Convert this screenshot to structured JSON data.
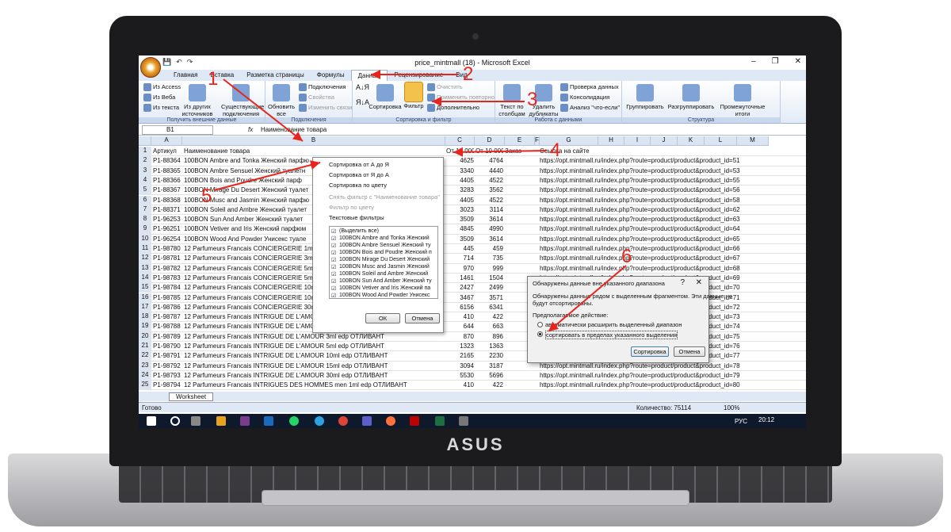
{
  "window": {
    "title": "price_mintmall (18) - Microsoft Excel",
    "controls": [
      "–",
      "❐",
      "✕"
    ]
  },
  "qat": [
    "💾",
    "↶",
    "↷"
  ],
  "tabs": [
    "Главная",
    "Вставка",
    "Разметка страницы",
    "Формулы",
    "Данные",
    "Рецензирование",
    "Вид"
  ],
  "ribbon": {
    "ext": {
      "access": "Из Access",
      "web": "Из Веба",
      "text": "Из текста",
      "other": "Из других источников",
      "existing": "Существующие подключения",
      "label": "Получить внешние данные"
    },
    "conn": {
      "refresh": "Обновить все",
      "connections": "Подключения",
      "properties": "Свойства",
      "editlinks": "Изменить связи",
      "label": "Подключения"
    },
    "sort": {
      "sort": "Сортировка",
      "filter": "Фильтр",
      "clear": "Очистить",
      "reapply": "Применить повторно",
      "advanced": "Дополнительно",
      "label": "Сортировка и фильтр"
    },
    "tools": {
      "text": "Текст по столбцам",
      "dup": "Удалить дубликаты",
      "validation": "Проверка данных",
      "consolidate": "Консолидация",
      "whatif": "Анализ \"что-если\"",
      "label": "Работа с данными"
    },
    "outline": {
      "group": "Группировать",
      "ungroup": "Разгруппировать",
      "subtotal": "Промежуточные итоги",
      "label": "Структура"
    }
  },
  "formula": {
    "cell": "B1",
    "fx": "fx",
    "value": "Наименование товара"
  },
  "columns": [
    "A",
    "B",
    "C",
    "D",
    "E",
    "F",
    "G",
    "H",
    "I",
    "J",
    "K",
    "L",
    "M"
  ],
  "rows": [
    {
      "n": "1",
      "a": "Артикул",
      "b": "Наименование товара",
      "c": "От 10 000",
      "d": "От 10 000",
      "e": "Заказ",
      "f": "Ссылка на сайте"
    },
    {
      "n": "2",
      "a": "P1-88364",
      "b": "100BON Ambre and Tonka Женский парфю",
      "c": "4625",
      "d": "4764",
      "e": "",
      "f": "https://opt.mintmall.ru/index.php?route=product/product&product_id=51"
    },
    {
      "n": "3",
      "a": "P1-88365",
      "b": "100BON Ambre Sensuel Женский туалетн",
      "c": "3340",
      "d": "4440",
      "e": "",
      "f": "https://opt.mintmall.ru/index.php?route=product/product&product_id=53"
    },
    {
      "n": "4",
      "a": "P1-88366",
      "b": "100BON Bois and Poudre Женский парф",
      "c": "4405",
      "d": "4522",
      "e": "",
      "f": "https://opt.mintmall.ru/index.php?route=product/product&product_id=55"
    },
    {
      "n": "5",
      "a": "P1-88367",
      "b": "100BON Mirage Du Desert Женский туалет",
      "c": "3283",
      "d": "3562",
      "e": "",
      "f": "https://opt.mintmall.ru/index.php?route=product/product&product_id=56"
    },
    {
      "n": "6",
      "a": "P1-88368",
      "b": "100BON Musc and Jasmin Женский парфю",
      "c": "4405",
      "d": "4522",
      "e": "",
      "f": "https://opt.mintmall.ru/index.php?route=product/product&product_id=58"
    },
    {
      "n": "7",
      "a": "P1-88371",
      "b": "100BON Soleil and Ambre Женский туалет",
      "c": "3023",
      "d": "3114",
      "e": "",
      "f": "https://opt.mintmall.ru/index.php?route=product/product&product_id=62"
    },
    {
      "n": "8",
      "a": "P1-96253",
      "b": "100BON Sun And Amber Женский туалет",
      "c": "3509",
      "d": "3614",
      "e": "",
      "f": "https://opt.mintmall.ru/index.php?route=product/product&product_id=63"
    },
    {
      "n": "9",
      "a": "P1-96251",
      "b": "100BON Vetiver and Iris Женский парфюм",
      "c": "4845",
      "d": "4990",
      "e": "",
      "f": "https://opt.mintmall.ru/index.php?route=product/product&product_id=64"
    },
    {
      "n": "10",
      "a": "P1-96254",
      "b": "100BON Wood And Powder Унисекс туале",
      "c": "3509",
      "d": "3614",
      "e": "",
      "f": "https://opt.mintmall.ru/index.php?route=product/product&product_id=65"
    },
    {
      "n": "11",
      "a": "P1-98780",
      "b": "12 Parfumeurs Francais CONCIERGERIE 1ml",
      "c": "445",
      "d": "459",
      "e": "",
      "f": "https://opt.mintmall.ru/index.php?route=product/product&product_id=66"
    },
    {
      "n": "12",
      "a": "P1-98781",
      "b": "12 Parfumeurs Francais CONCIERGERIE 3ml",
      "c": "714",
      "d": "735",
      "e": "",
      "f": "https://opt.mintmall.ru/index.php?route=product/product&product_id=67"
    },
    {
      "n": "13",
      "a": "P1-98782",
      "b": "12 Parfumeurs Francais CONCIERGERIE 5ml",
      "c": "970",
      "d": "999",
      "e": "",
      "f": "https://opt.mintmall.ru/index.php?route=product/product&product_id=68"
    },
    {
      "n": "14",
      "a": "P1-98783",
      "b": "12 Parfumeurs Francais CONCIERGERIE 5ml",
      "c": "1461",
      "d": "1504",
      "e": "",
      "f": "https://opt.mintmall.ru/index.php?route=product/product&product_id=69"
    },
    {
      "n": "15",
      "a": "P1-98784",
      "b": "12 Parfumeurs Francais CONCIERGERIE 10m",
      "c": "2427",
      "d": "2499",
      "e": "",
      "f": "https://opt.mintmall.ru/index.php?route=product/product&product_id=70"
    },
    {
      "n": "16",
      "a": "P1-98785",
      "b": "12 Parfumeurs Francais CONCIERGERIE 10m",
      "c": "3467",
      "d": "3571",
      "e": "",
      "f": "https://opt.mintmall.ru/index.php?route=product/product&product_id=71"
    },
    {
      "n": "17",
      "a": "P1-98786",
      "b": "12 Parfumeurs Francais CONCIERGERIE 30m",
      "c": "6156",
      "d": "6341",
      "e": "",
      "f": "https://opt.mintmall.ru/index.php?route=product/product&product_id=72"
    },
    {
      "n": "18",
      "a": "P1-98787",
      "b": "12 Parfumeurs Francais INTRIGUE DE L'AMOU",
      "c": "410",
      "d": "422",
      "e": "",
      "f": "https://opt.mintmall.ru/index.php?route=product/product&product_id=73"
    },
    {
      "n": "19",
      "a": "P1-98788",
      "b": "12 Parfumeurs Francais INTRIGUE DE L'AMOU",
      "c": "644",
      "d": "663",
      "e": "",
      "f": "https://opt.mintmall.ru/index.php?route=product/product&product_id=74"
    },
    {
      "n": "20",
      "a": "P1-98789",
      "b": "12 Parfumeurs Francais INTRIGUE DE L'AMOUR 3ml edp ОТЛИВАНТ",
      "c": "870",
      "d": "896",
      "e": "",
      "f": "https://opt.mintmall.ru/index.php?route=product/product&product_id=75"
    },
    {
      "n": "21",
      "a": "P1-98790",
      "b": "12 Parfumeurs Francais INTRIGUE DE L'AMOUR 5ml edp ОТЛИВАНТ",
      "c": "1323",
      "d": "1363",
      "e": "",
      "f": "https://opt.mintmall.ru/index.php?route=product/product&product_id=76"
    },
    {
      "n": "22",
      "a": "P1-98791",
      "b": "12 Parfumeurs Francais INTRIGUE DE L'AMOUR 10ml edp ОТЛИВАНТ",
      "c": "2165",
      "d": "2230",
      "e": "",
      "f": "https://opt.mintmall.ru/index.php?route=product/product&product_id=77"
    },
    {
      "n": "23",
      "a": "P1-98792",
      "b": "12 Parfumeurs Francais INTRIGUE DE L'AMOUR 15ml edp ОТЛИВАНТ",
      "c": "3094",
      "d": "3187",
      "e": "",
      "f": "https://opt.mintmall.ru/index.php?route=product/product&product_id=78"
    },
    {
      "n": "24",
      "a": "P1-98793",
      "b": "12 Parfumeurs Francais INTRIGUE DE L'AMOUR 30ml edp ОТЛИВАНТ",
      "c": "5530",
      "d": "5696",
      "e": "",
      "f": "https://opt.mintmall.ru/index.php?route=product/product&product_id=79"
    },
    {
      "n": "25",
      "a": "P1-98794",
      "b": "12 Parfumeurs Francais INTRIGUES DES HOMMES men 1ml edp ОТЛИВАНТ",
      "c": "410",
      "d": "422",
      "e": "",
      "f": "https://opt.mintmall.ru/index.php?route=product/product&product_id=80"
    }
  ],
  "dropdown": {
    "sort_az": "Сортировка от А до Я",
    "sort_za": "Сортировка от Я до А",
    "sort_color": "Сортировка по цвету",
    "clear": "Снять фильтр с \"Наименование товара\"",
    "filter_color": "Фильтр по цвету",
    "text_filters": "Текстовые фильтры",
    "items": [
      "(Выделить все)",
      "100BON Ambre and Tonka Женский",
      "100BON Ambre Sensuel Женский ту",
      "100BON Bois and Poudre Женский п",
      "100BON Mirage Du Desert Женский",
      "100BON Musc and Jasmin Женский",
      "100BON Soleil and Ambre Женский",
      "100BON Sun And Amber Женский ту",
      "100BON Vetiver and Iris Женский па",
      "100BON Wood And Powder Унисекс"
    ],
    "ok": "ОК",
    "cancel": "Отмена"
  },
  "dialog": {
    "title": "Обнаружены данные вне указанного диапазона",
    "help": "?",
    "close": "✕",
    "text1": "Обнаружены данные рядом с выделенным фрагментом. Эти данные не",
    "text2": "будут отсортированы.",
    "prompt": "Предполагаемое действие:",
    "opt1": "автоматически расширить выделенный диапазон",
    "opt2": "сортировать в пределах указанного выделения",
    "sort_btn": "Сортировка",
    "cancel_btn": "Отмена"
  },
  "sheet": {
    "tab": "Worksheet"
  },
  "status": {
    "ready": "Готово",
    "count": "Количество: 75114",
    "zoom": "100%"
  },
  "taskbar": {
    "lang": "РУС",
    "time": "20:12"
  },
  "brand": "ASUS",
  "annotations": [
    "1",
    "2",
    "3",
    "4",
    "5",
    "6"
  ]
}
